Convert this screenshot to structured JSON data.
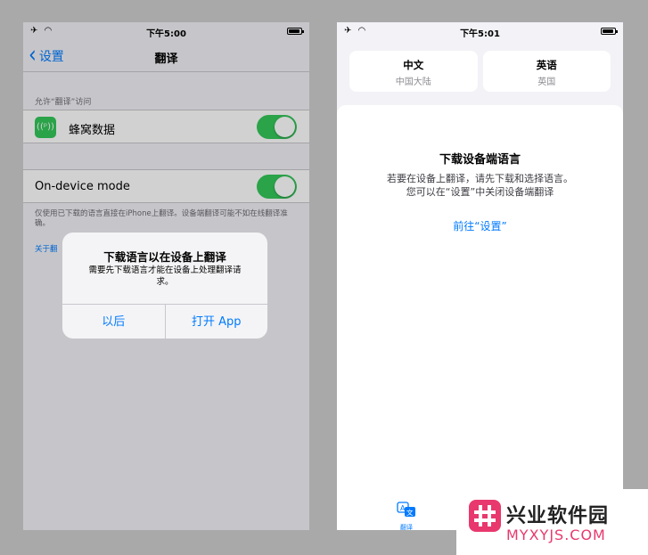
{
  "left": {
    "status": {
      "left_icons": "✈ ◠",
      "time": "下午5:00"
    },
    "nav": {
      "back_label": "设置",
      "title": "翻译"
    },
    "section_header": "允许“翻译”访问",
    "cellular": {
      "icon": "((ᵖ))",
      "label": "蜂窝数据",
      "enabled": true
    },
    "ondevice": {
      "label": "On-device mode",
      "enabled": true
    },
    "footnote": "仅使用已下载的语言直接在iPhone上翻译。设备端翻译可能不如在线翻译准确。",
    "about_link": "关于翻",
    "alert": {
      "title": "下载语言以在设备上翻译",
      "message": "需要先下载语言才能在设备上处理翻译请求。",
      "cancel_label": "以后",
      "open_label": "打开 App"
    }
  },
  "right": {
    "status": {
      "left_icons": "✈ ◠",
      "time": "下午5:01"
    },
    "source_lang": {
      "name": "中文",
      "region": "中国大陆"
    },
    "target_lang": {
      "name": "英语",
      "region": "英国"
    },
    "sheet": {
      "title": "下载设备端语言",
      "message_line1": "若要在设备上翻译，请先下载和选择语言。",
      "message_line2": "您可以在“设置”中关闭设备端翻译",
      "link": "前往“设置”"
    },
    "tab": {
      "label": "翻译",
      "icon": "translate-icon"
    }
  },
  "watermark": {
    "title": "兴业软件园",
    "domain": "MYXYJS.COM"
  },
  "colors": {
    "accent": "#007aff",
    "toggle_on": "#34c759",
    "brand": "#e8386d"
  }
}
